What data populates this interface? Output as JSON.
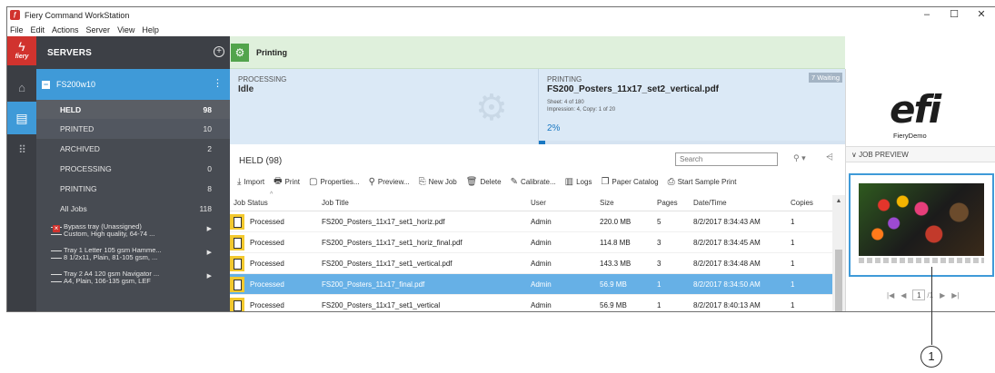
{
  "window": {
    "title": "Fiery Command WorkStation",
    "minimize": "–",
    "maximize": "☐",
    "close": "✕"
  },
  "menu": [
    "File",
    "Edit",
    "Actions",
    "Server",
    "View",
    "Help"
  ],
  "rail": {
    "logo_text": "fiery"
  },
  "servers": {
    "title": "SERVERS",
    "server_name": "FS200w10",
    "queues": [
      {
        "label": "HELD",
        "count": "98"
      },
      {
        "label": "PRINTED",
        "count": "10"
      },
      {
        "label": "ARCHIVED",
        "count": "2"
      },
      {
        "label": "PROCESSING",
        "count": "0"
      },
      {
        "label": "PRINTING",
        "count": "8"
      },
      {
        "label": "All Jobs",
        "count": "118"
      }
    ],
    "trays": [
      {
        "line1": "Bypass tray (Unassigned)",
        "line2": "Custom, High quality, 64-74 ..."
      },
      {
        "line1": "Tray 1 Letter 105 gsm Hamme...",
        "line2": "8 1/2x11, Plain, 81-105 gsm, ..."
      },
      {
        "line1": "Tray 2 A4 120 gsm Navigator ...",
        "line2": "A4, Plain, 106-135 gsm, LEF"
      }
    ]
  },
  "printing_bar": {
    "label": "Printing"
  },
  "processing": {
    "label": "PROCESSING",
    "value": "Idle"
  },
  "printing": {
    "label": "PRINTING",
    "file": "FS200_Posters_11x17_set2_vertical.pdf",
    "sheet": "Sheet: 4 of 180",
    "impression": "Impression: 4, Copy: 1 of 20",
    "percent_text": "2%",
    "progress": 0.02,
    "waiting": "7 Waiting"
  },
  "held": {
    "title": "HELD (98)",
    "search_placeholder": "Search"
  },
  "toolbar": [
    {
      "icon": "⤓",
      "label": "Import",
      "name": "import"
    },
    {
      "icon": "🖶",
      "label": "Print",
      "name": "print"
    },
    {
      "icon": "▢",
      "label": "Properties...",
      "name": "properties"
    },
    {
      "icon": "⚲",
      "label": "Preview...",
      "name": "preview"
    },
    {
      "icon": "⎘",
      "label": "New Job",
      "name": "new-job"
    },
    {
      "icon": "🗑",
      "label": "Delete",
      "name": "delete"
    },
    {
      "icon": "✎",
      "label": "Calibrate...",
      "name": "calibrate"
    },
    {
      "icon": "▥",
      "label": "Logs",
      "name": "logs"
    },
    {
      "icon": "❐",
      "label": "Paper Catalog",
      "name": "paper-catalog"
    },
    {
      "icon": "⎙",
      "label": "Start Sample Print",
      "name": "start-sample-print"
    }
  ],
  "table": {
    "columns": [
      "Job Status",
      "Job Title",
      "User",
      "Size",
      "Pages",
      "Date/Time",
      "Copies"
    ],
    "rows": [
      {
        "status": "Processed",
        "title": "FS200_Posters_11x17_set1_horiz.pdf",
        "user": "Admin",
        "size": "220.0 MB",
        "pages": "5",
        "date": "8/2/2017 8:34:43 AM",
        "copies": "1"
      },
      {
        "status": "Processed",
        "title": "FS200_Posters_11x17_set1_horiz_final.pdf",
        "user": "Admin",
        "size": "114.8 MB",
        "pages": "3",
        "date": "8/2/2017 8:34:45 AM",
        "copies": "1"
      },
      {
        "status": "Processed",
        "title": "FS200_Posters_11x17_set1_vertical.pdf",
        "user": "Admin",
        "size": "143.3 MB",
        "pages": "3",
        "date": "8/2/2017 8:34:48 AM",
        "copies": "1"
      },
      {
        "status": "Processed",
        "title": "FS200_Posters_11x17_final.pdf",
        "user": "Admin",
        "size": "56.9 MB",
        "pages": "1",
        "date": "8/2/2017 8:34:50 AM",
        "copies": "1"
      },
      {
        "status": "Processed",
        "title": "FS200_Posters_11x17_set1_vertical",
        "user": "Admin",
        "size": "56.9 MB",
        "pages": "1",
        "date": "8/2/2017 8:40:13 AM",
        "copies": "1"
      }
    ],
    "selected_index": 3
  },
  "preview": {
    "logo": "efi",
    "server_label": "FieryDemo",
    "header": "JOB PREVIEW",
    "pager": {
      "first": "|◀",
      "prev": "◀",
      "page": "1",
      "total": "/1",
      "next": "▶",
      "last": "▶|"
    }
  },
  "callout": {
    "number": "1"
  },
  "colors": {
    "accent_blue": "#3f9ad8",
    "fiery_red": "#d1332e",
    "printing_green": "#52a44c",
    "status_yellow": "#f3c92e"
  }
}
